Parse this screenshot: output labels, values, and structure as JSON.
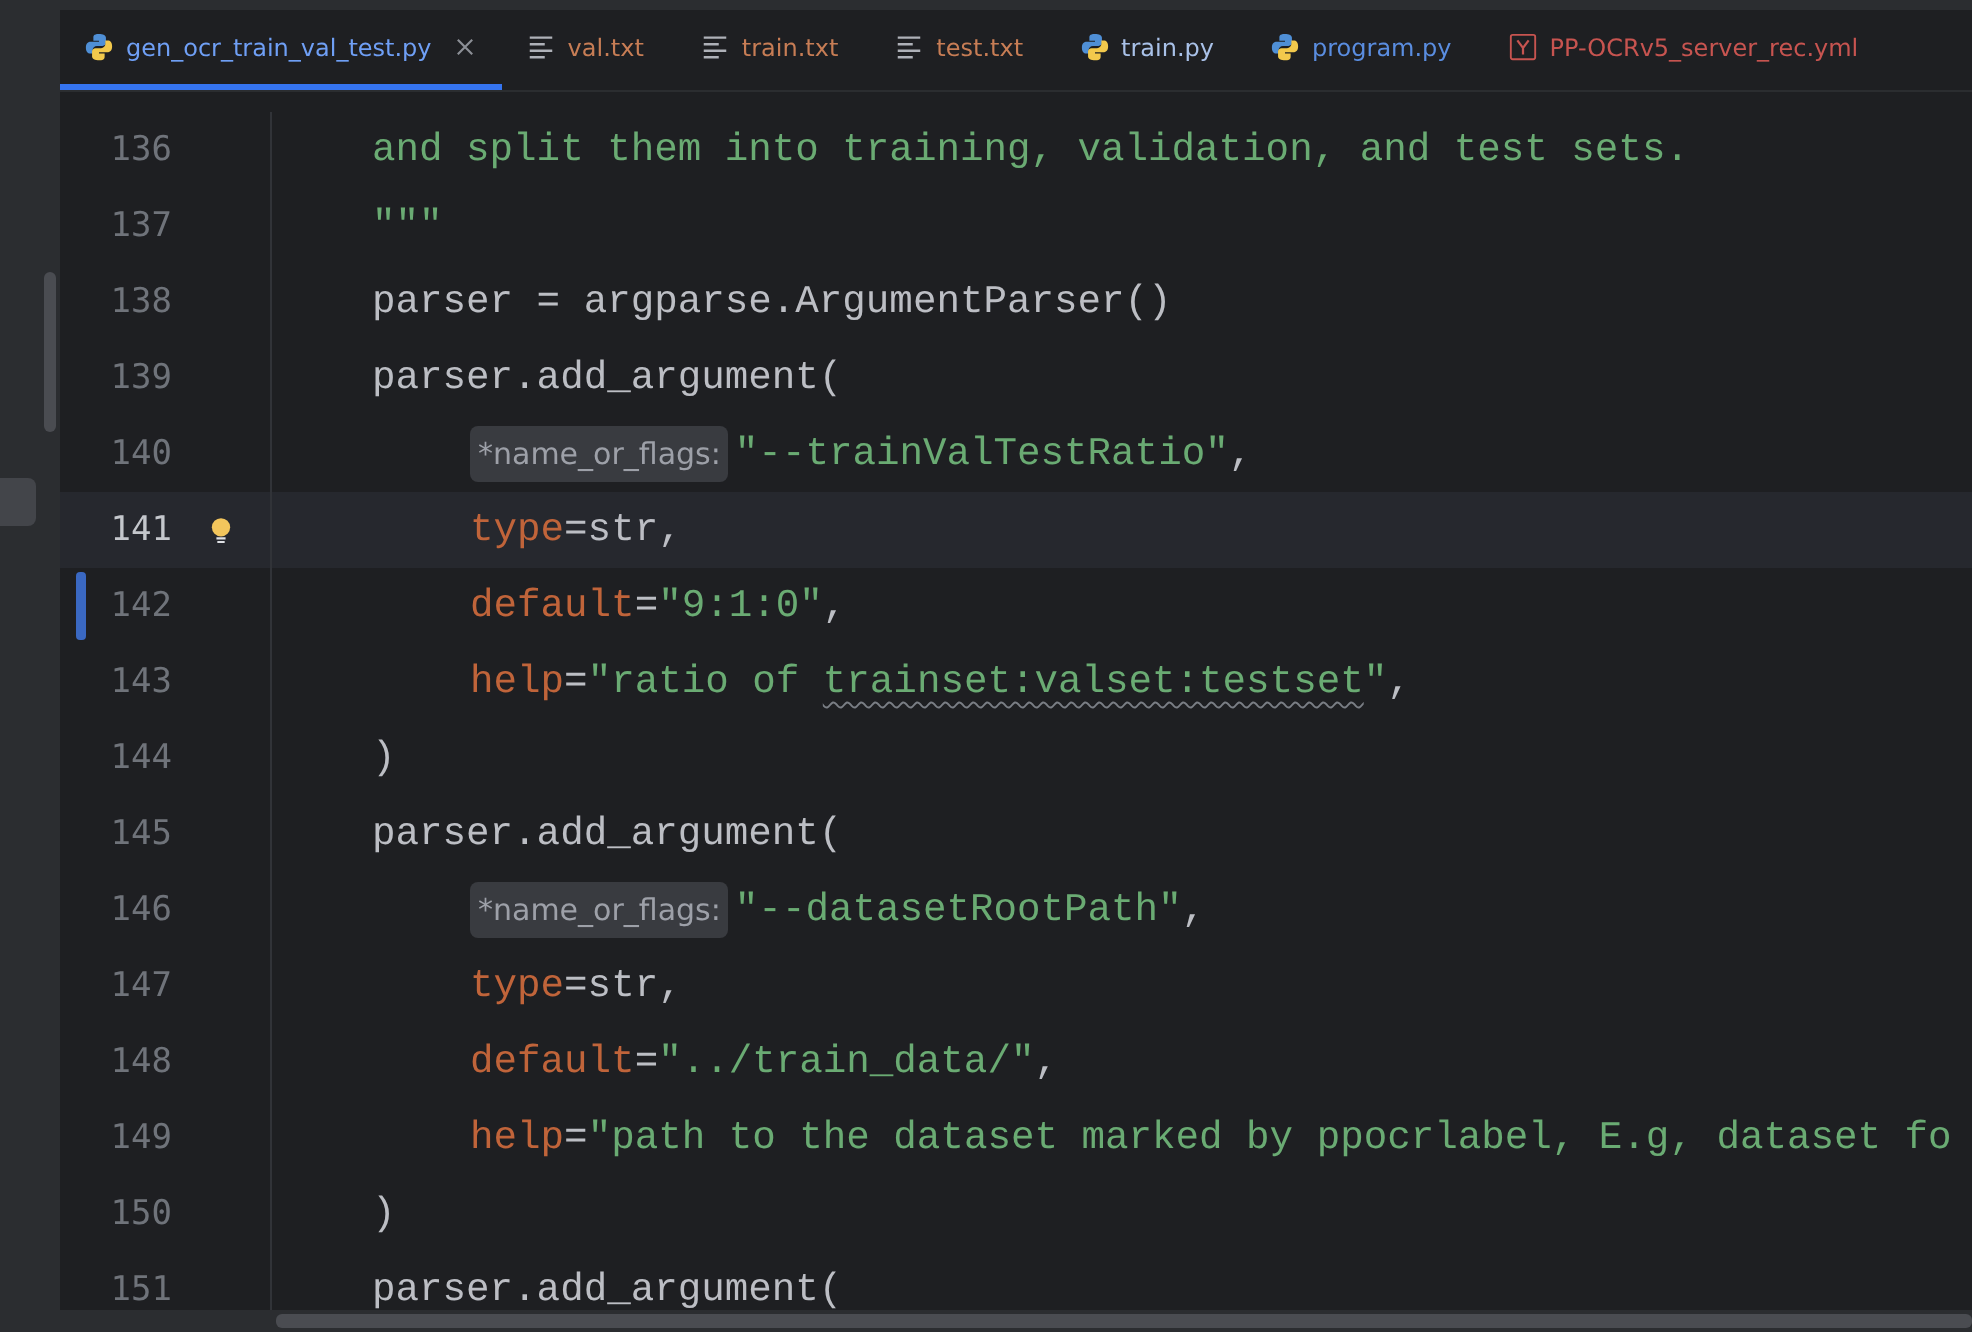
{
  "tabs": [
    {
      "label": "gen_ocr_train_val_test.py",
      "kind": "python",
      "color": "#6f9ff5",
      "selected": true,
      "closable": true
    },
    {
      "label": "val.txt",
      "kind": "text",
      "color": "#c77d55",
      "selected": false,
      "closable": false
    },
    {
      "label": "train.txt",
      "kind": "text",
      "color": "#c77d55",
      "selected": false,
      "closable": false
    },
    {
      "label": "test.txt",
      "kind": "text",
      "color": "#c77d55",
      "selected": false,
      "closable": false
    },
    {
      "label": "train.py",
      "kind": "python",
      "color": "#a9c1e8",
      "selected": false,
      "closable": false
    },
    {
      "label": "program.py",
      "kind": "python",
      "color": "#5a8de0",
      "selected": false,
      "closable": false
    },
    {
      "label": "PP-OCRv5_server_rec.yml",
      "kind": "yaml",
      "color": "#c75450",
      "selected": false,
      "closable": false
    }
  ],
  "lines": [
    {
      "number": "136",
      "kind": "top",
      "current": false,
      "changed": false,
      "bulb": false,
      "segments": [
        {
          "kind": "string",
          "text": "and split them into training, validation, and test sets."
        }
      ]
    },
    {
      "number": "137",
      "kind": "top",
      "current": false,
      "changed": false,
      "bulb": false,
      "segments": [
        {
          "kind": "string",
          "text": "\"\"\""
        }
      ]
    },
    {
      "number": "138",
      "kind": "top",
      "current": false,
      "changed": false,
      "bulb": false,
      "segments": [
        {
          "kind": "code",
          "text": "parser = argparse.ArgumentParser()"
        }
      ]
    },
    {
      "number": "139",
      "kind": "top",
      "current": false,
      "changed": false,
      "bulb": false,
      "segments": [
        {
          "kind": "code",
          "text": "parser.add_argument("
        }
      ]
    },
    {
      "number": "140",
      "kind": "nested",
      "current": false,
      "changed": false,
      "bulb": false,
      "segments": [
        {
          "kind": "hint",
          "text": "*name_or_flags:"
        },
        {
          "kind": "string",
          "text": "\"--trainValTestRatio\""
        },
        {
          "kind": "code",
          "text": ","
        }
      ]
    },
    {
      "number": "141",
      "kind": "nested",
      "current": true,
      "changed": false,
      "bulb": true,
      "segments": [
        {
          "kind": "param",
          "text": "type"
        },
        {
          "kind": "code",
          "text": "=str,"
        }
      ]
    },
    {
      "number": "142",
      "kind": "nested",
      "current": false,
      "changed": true,
      "bulb": false,
      "segments": [
        {
          "kind": "param",
          "text": "default"
        },
        {
          "kind": "code",
          "text": "="
        },
        {
          "kind": "string",
          "text": "\"9:1:0\""
        },
        {
          "kind": "code",
          "text": ","
        }
      ]
    },
    {
      "number": "143",
      "kind": "nested",
      "current": false,
      "changed": false,
      "bulb": false,
      "segments": [
        {
          "kind": "param",
          "text": "help"
        },
        {
          "kind": "code",
          "text": "="
        },
        {
          "kind": "string",
          "text": "\"ratio of "
        },
        {
          "kind": "typo",
          "text": "trainset:valset:testset"
        },
        {
          "kind": "string",
          "text": "\""
        },
        {
          "kind": "code",
          "text": ","
        }
      ]
    },
    {
      "number": "144",
      "kind": "top",
      "current": false,
      "changed": false,
      "bulb": false,
      "segments": [
        {
          "kind": "code",
          "text": ")"
        }
      ]
    },
    {
      "number": "145",
      "kind": "top",
      "current": false,
      "changed": false,
      "bulb": false,
      "segments": [
        {
          "kind": "code",
          "text": "parser.add_argument("
        }
      ]
    },
    {
      "number": "146",
      "kind": "nested",
      "current": false,
      "changed": false,
      "bulb": false,
      "segments": [
        {
          "kind": "hint",
          "text": "*name_or_flags:"
        },
        {
          "kind": "string",
          "text": "\"--datasetRootPath\""
        },
        {
          "kind": "code",
          "text": ","
        }
      ]
    },
    {
      "number": "147",
      "kind": "nested",
      "current": false,
      "changed": false,
      "bulb": false,
      "segments": [
        {
          "kind": "param",
          "text": "type"
        },
        {
          "kind": "code",
          "text": "=str,"
        }
      ]
    },
    {
      "number": "148",
      "kind": "nested",
      "current": false,
      "changed": false,
      "bulb": false,
      "segments": [
        {
          "kind": "param",
          "text": "default"
        },
        {
          "kind": "code",
          "text": "="
        },
        {
          "kind": "string",
          "text": "\"../train_data/\""
        },
        {
          "kind": "code",
          "text": ","
        }
      ]
    },
    {
      "number": "149",
      "kind": "nested",
      "current": false,
      "changed": false,
      "bulb": false,
      "segments": [
        {
          "kind": "param",
          "text": "help"
        },
        {
          "kind": "code",
          "text": "="
        },
        {
          "kind": "string",
          "text": "\"path to the dataset marked by ppocrlabel, E.g, dataset fo"
        }
      ]
    },
    {
      "number": "150",
      "kind": "top",
      "current": false,
      "changed": false,
      "bulb": false,
      "segments": [
        {
          "kind": "code",
          "text": ")"
        }
      ]
    },
    {
      "number": "151",
      "kind": "top",
      "current": false,
      "changed": false,
      "bulb": false,
      "segments": [
        {
          "kind": "code",
          "text": "parser.add_argument("
        }
      ]
    }
  ]
}
